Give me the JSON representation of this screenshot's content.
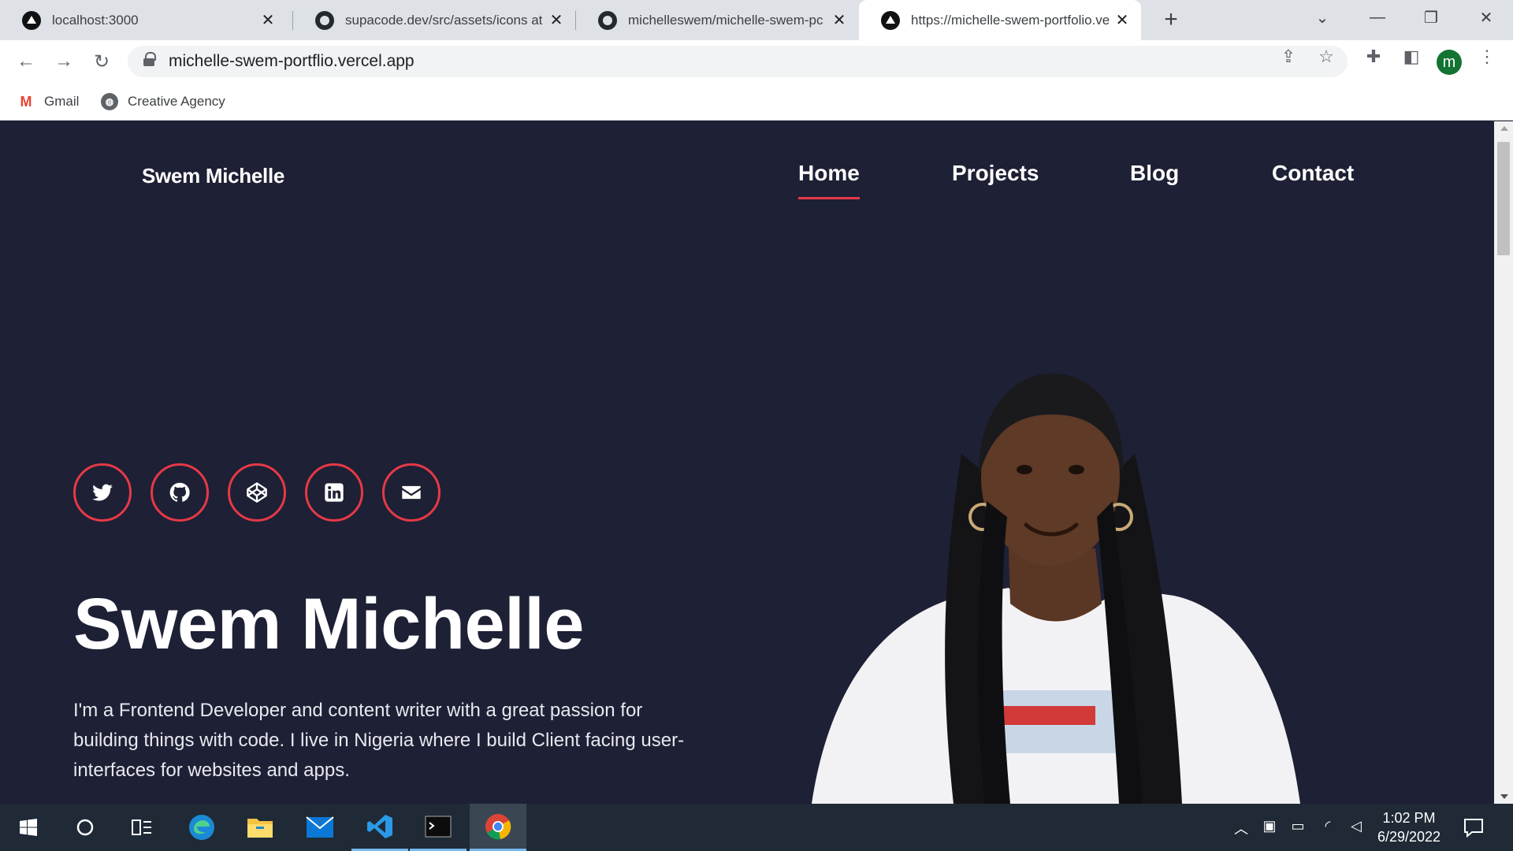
{
  "browser": {
    "tabs": [
      {
        "title": "localhost:3000",
        "favicon": "vercel-triangle-icon",
        "active": false
      },
      {
        "title": "supacode.dev/src/assets/icons at",
        "favicon": "github-icon",
        "active": false
      },
      {
        "title": "michelleswem/michelle-swem-pc",
        "favicon": "github-icon",
        "active": false
      },
      {
        "title": "https://michelle-swem-portfolio.ve",
        "favicon": "vercel-triangle-icon",
        "active": true
      }
    ],
    "new_tab_label": "+",
    "url": "michelle-swem-portflio.vercel.app",
    "profile_initial": "m",
    "bookmarks": [
      {
        "label": "Gmail",
        "icon": "gmail-icon"
      },
      {
        "label": "Creative Agency",
        "icon": "globe-icon"
      }
    ]
  },
  "site": {
    "logo": "Swem Michelle",
    "nav": [
      {
        "label": "Home",
        "active": true
      },
      {
        "label": "Projects",
        "active": false
      },
      {
        "label": "Blog",
        "active": false
      },
      {
        "label": "Contact",
        "active": false
      }
    ],
    "social": [
      {
        "name": "twitter-icon"
      },
      {
        "name": "github-icon"
      },
      {
        "name": "codepen-icon"
      },
      {
        "name": "linkedin-icon"
      },
      {
        "name": "envelope-icon"
      }
    ],
    "hero": {
      "name": "Swem Michelle",
      "bio": "I'm a Frontend Developer and content writer with a great passion for building things with code. I live in Nigeria where I build Client facing user-interfaces for websites and apps."
    },
    "colors": {
      "background": "#1e2035",
      "accent": "#e63946",
      "text": "#ffffff"
    }
  },
  "taskbar": {
    "apps": [
      "windows-start-icon",
      "cortana-icon",
      "task-view-icon",
      "edge-icon",
      "file-explorer-icon",
      "mail-icon",
      "vscode-icon",
      "terminal-icon",
      "chrome-icon"
    ],
    "time": "1:02 PM",
    "date": "6/29/2022"
  }
}
